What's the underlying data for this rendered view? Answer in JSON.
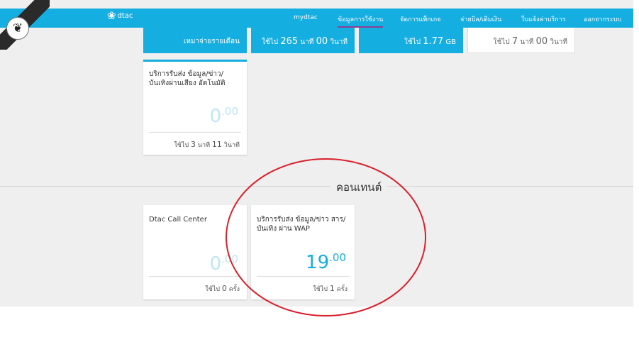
{
  "brand": {
    "logo_text": "dtac",
    "logo_mark": "❀"
  },
  "nav": {
    "items": [
      {
        "label": "mydtac"
      },
      {
        "label": "ข้อมูลการใช้งาน",
        "active": true
      },
      {
        "label": "จัดการแพ็กเกจ"
      },
      {
        "label": "จ่ายบิล/เติมเงิน"
      },
      {
        "label": "ใบแจ้งค่าบริการ"
      },
      {
        "label": "ออกจากระบบ"
      }
    ]
  },
  "mourning": {
    "icon": "mourning-ribbon-icon",
    "glyph": "❦"
  },
  "top_row": [
    {
      "label": "เหมาจ่ายรายเดือน",
      "style": "blue"
    },
    {
      "prefix": "ใช้ไป",
      "num1": "265",
      "unit1": "นาที",
      "num2": "00",
      "unit2": "วินาที",
      "style": "blue"
    },
    {
      "prefix": "ใช้ไป",
      "num1": "1.77",
      "unit1": "GB",
      "style": "blue"
    },
    {
      "prefix": "ใช้ไป",
      "num1": "7",
      "unit1": "นาที",
      "num2": "00",
      "unit2": "วินาที",
      "style": "white"
    }
  ],
  "voice_card": {
    "title": "บริการรับส่ง ข้อมูล/ข่าว/บันเทิงผ่านเสียง อัตโนมัติ",
    "amount_int": "0",
    "amount_dec": ".00",
    "usage_prefix": "ใช้ไป",
    "usage_num1": "3",
    "usage_unit1": "นาที",
    "usage_num2": "11",
    "usage_unit2": "วินาที"
  },
  "section": {
    "title": "คอนเทนต์"
  },
  "content_cards": [
    {
      "title": "Dtac Call Center",
      "amount_int": "0",
      "amount_dec": ".00",
      "usage_prefix": "ใช้ไป",
      "usage_num": "0",
      "usage_unit": "ครั้ง"
    },
    {
      "title": "บริการรับส่ง ข้อมูล/ข่าว สาร/บันเทิง ผ่าน WAP",
      "amount_int": "19",
      "amount_dec": ".00",
      "usage_prefix": "ใช้ไป",
      "usage_num": "1",
      "usage_unit": "ครั้ง"
    }
  ],
  "colors": {
    "brand_blue": "#15aee0",
    "active_underline": "#8d3d93",
    "annotation_red": "#d9202a"
  }
}
